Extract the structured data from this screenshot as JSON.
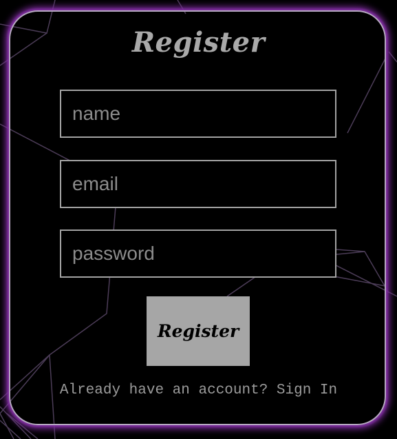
{
  "form": {
    "title": "Register",
    "name_placeholder": "name",
    "email_placeholder": "email",
    "password_placeholder": "password",
    "submit_label": "Register",
    "signin_prompt": "Already have an account? ",
    "signin_link": "Sign In"
  },
  "colors": {
    "background": "#000000",
    "card_border": "#b7a9c2",
    "card_glow": "#7a2a9a",
    "text_gray": "#a9a9a9",
    "button_fill": "#a6a6a6",
    "network_lines": "#5a4868"
  }
}
